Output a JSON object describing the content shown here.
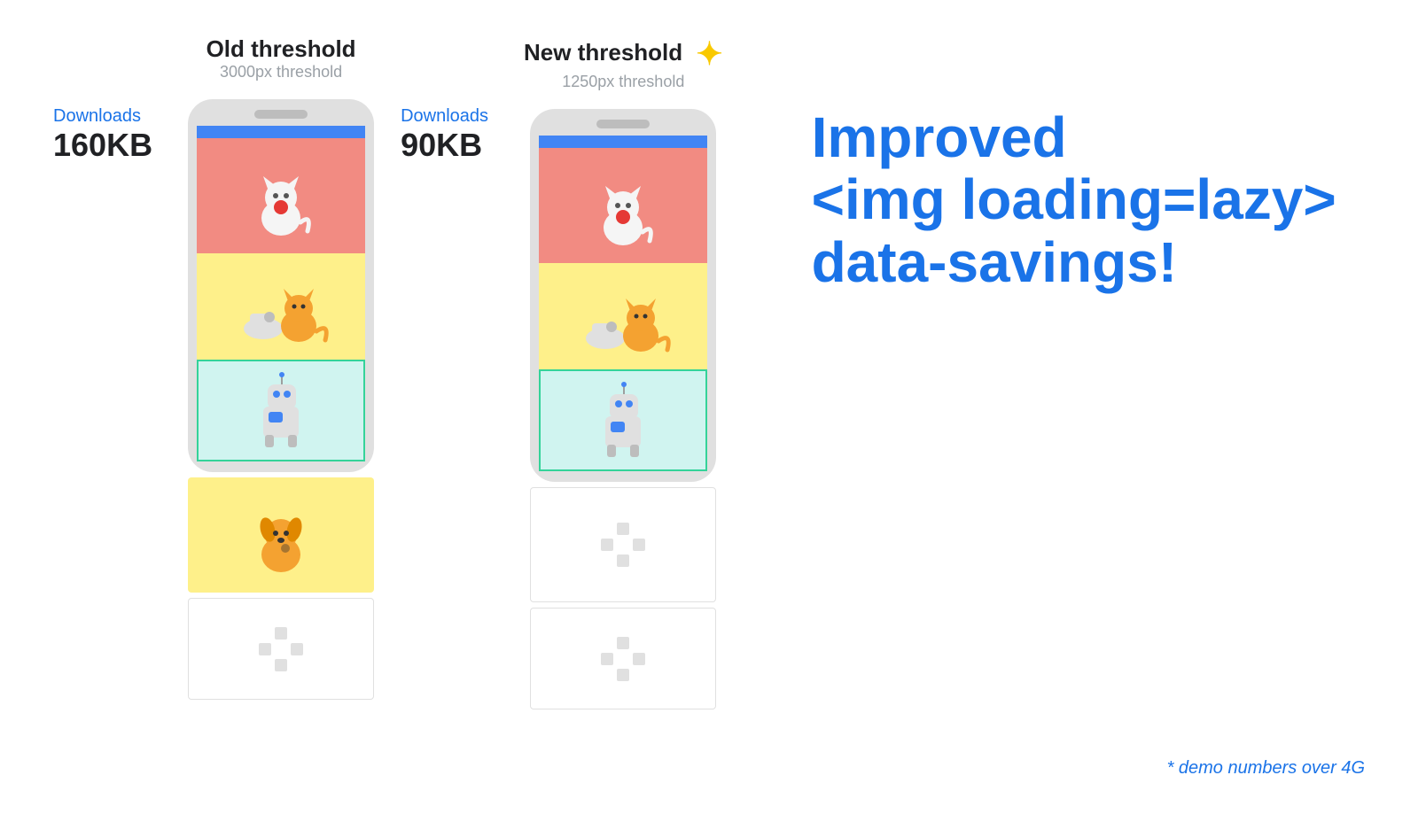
{
  "page": {
    "background": "#ffffff"
  },
  "left_column": {
    "title": "Old threshold",
    "subtitle": "3000px threshold",
    "downloads_label": "Downloads",
    "downloads_size": "160KB"
  },
  "right_column": {
    "title": "New threshold",
    "subtitle": "1250px threshold",
    "downloads_label": "Downloads",
    "downloads_size": "90KB",
    "has_sparkle": true
  },
  "main_text": {
    "line1": "Improved",
    "line2": "<img loading=lazy>",
    "line3": "data-savings!"
  },
  "demo_note": "* demo numbers over 4G",
  "sparkle_char": "✦",
  "loading_spinner_char": "✦"
}
